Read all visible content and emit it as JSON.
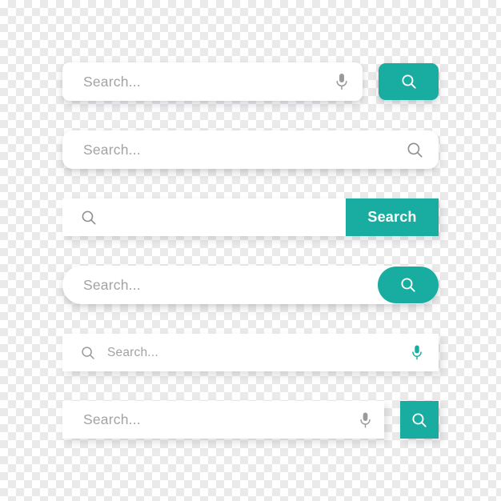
{
  "theme": {
    "accent_color": "#18ada0",
    "field_background": "#ffffff",
    "placeholder_color": "#a3a3a5",
    "icon_gray": "#9a9a9c",
    "canvas_pattern": "transparent-checkerboard"
  },
  "search_bars": [
    {
      "id": "search-bar-1",
      "style": "rounded-field-with-detached-teal-icon-button",
      "placeholder": "Search...",
      "value": "",
      "left_icon": null,
      "right_icon": "microphone-icon",
      "button": {
        "label": "",
        "icon": "search-icon",
        "shape": "rounded-rect",
        "color": "#18ada0"
      }
    },
    {
      "id": "search-bar-2",
      "style": "rounded-field-with-inline-gray-icon",
      "placeholder": "Search...",
      "value": "",
      "left_icon": null,
      "right_icon": "search-icon",
      "button": null
    },
    {
      "id": "search-bar-3",
      "style": "square-field-with-attached-teal-text-button",
      "placeholder": "",
      "value": "",
      "left_icon": "search-icon",
      "right_icon": null,
      "button": {
        "label": "Search",
        "icon": null,
        "shape": "square",
        "color": "#18ada0"
      }
    },
    {
      "id": "search-bar-4",
      "style": "pill-field-with-embedded-teal-pill-button",
      "placeholder": "Search...",
      "value": "",
      "left_icon": null,
      "right_icon": null,
      "button": {
        "label": "",
        "icon": "search-icon",
        "shape": "pill",
        "color": "#18ada0"
      }
    },
    {
      "id": "search-bar-5",
      "style": "square-field-with-left-icon-and-teal-microphone",
      "placeholder": "Search...",
      "value": "",
      "left_icon": "search-icon",
      "right_icon": "microphone-icon",
      "button": null
    },
    {
      "id": "search-bar-6",
      "style": "square-field-with-detached-teal-square-button",
      "placeholder": "Search...",
      "value": "",
      "left_icon": null,
      "right_icon": "microphone-icon",
      "button": {
        "label": "",
        "icon": "search-icon",
        "shape": "square",
        "color": "#18ada0"
      }
    }
  ]
}
